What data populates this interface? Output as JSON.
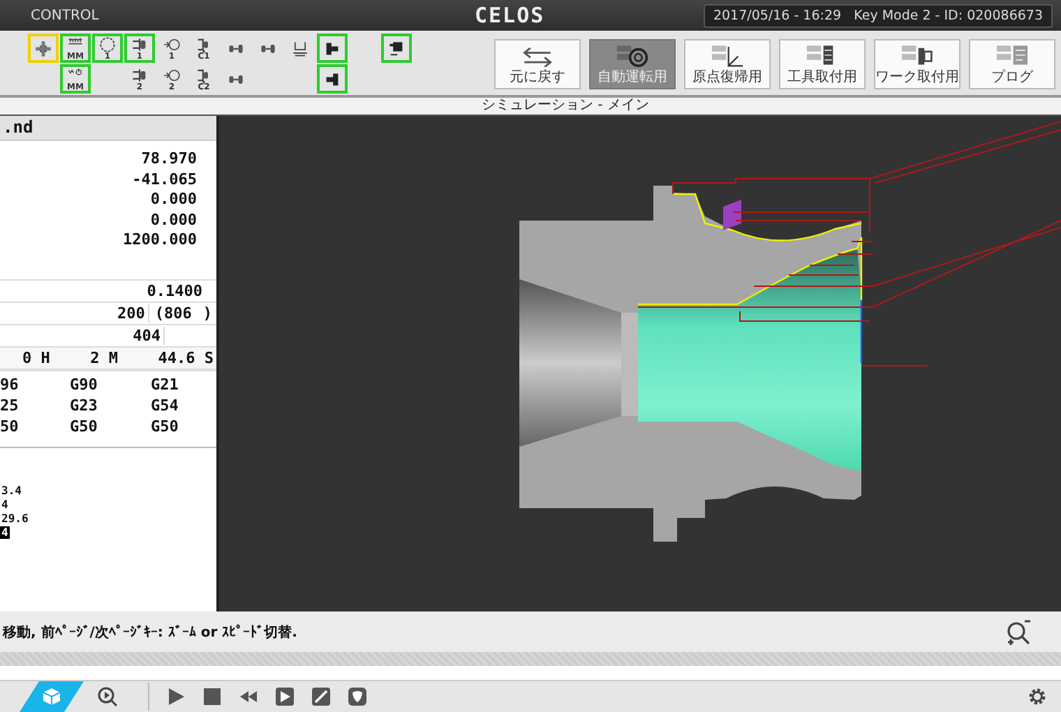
{
  "header": {
    "title": "CONTROL",
    "logo": "CELOS",
    "status": "2017/05/16 - 16:29   Key Mode 2 - ID: 020086673"
  },
  "toolbar": {
    "rows": [
      [
        {
          "kind": "chuck",
          "selected": true,
          "on": false
        },
        {
          "kind": "scale",
          "sub": "MM",
          "selected": false,
          "on": true
        },
        {
          "kind": "dial",
          "sub": "1",
          "selected": false,
          "on": true
        },
        {
          "kind": "clamp",
          "sub": "1",
          "selected": false,
          "on": true
        },
        {
          "kind": "feed",
          "sub": "1",
          "selected": false,
          "on": false
        },
        {
          "kind": "clamp-c",
          "sub": "C1",
          "selected": false,
          "on": false
        },
        {
          "kind": "spindle",
          "selected": false,
          "on": false
        },
        {
          "kind": "spindle",
          "selected": false,
          "on": false
        },
        {
          "kind": "tailstock",
          "selected": false,
          "on": false
        },
        {
          "kind": "jaw-left",
          "selected": false,
          "on": true
        },
        {
          "kind": "blank"
        },
        {
          "kind": "door",
          "selected": false,
          "on": true
        }
      ],
      [
        {
          "kind": "blank"
        },
        {
          "kind": "timer",
          "sub": "MM",
          "selected": false,
          "on": true
        },
        {
          "kind": "blank"
        },
        {
          "kind": "clamp",
          "sub": "2",
          "selected": false,
          "on": false
        },
        {
          "kind": "feed",
          "sub": "2",
          "selected": false,
          "on": false
        },
        {
          "kind": "clamp-c",
          "sub": "C2",
          "selected": false,
          "on": false
        },
        {
          "kind": "spindle",
          "selected": false,
          "on": false
        },
        {
          "kind": "blank"
        },
        {
          "kind": "blank"
        },
        {
          "kind": "jaw-right",
          "selected": false,
          "on": true
        }
      ]
    ]
  },
  "mode_buttons": [
    {
      "kind": "back",
      "label": "元に戻す",
      "selected": false
    },
    {
      "kind": "auto",
      "label": "自動運転用",
      "selected": true
    },
    {
      "kind": "origin",
      "label": "原点復帰用",
      "selected": false
    },
    {
      "kind": "tool",
      "label": "工具取付用",
      "selected": false
    },
    {
      "kind": "work",
      "label": "ワーク取付用",
      "selected": false
    },
    {
      "kind": "program",
      "label": "プログ",
      "selected": false
    }
  ],
  "panel": {
    "title": "シミュレーション - メイン"
  },
  "program": {
    "file": ".nd",
    "axes": [
      "78.970",
      "-41.065",
      "0.000",
      "0.000",
      "1200.000"
    ],
    "feed": "0.1400",
    "spindle": [
      "200",
      "(",
      "806",
      ")"
    ],
    "row_3": "404",
    "counters": [
      "0 H",
      "2 M",
      "44.6 S"
    ],
    "modal": [
      [
        "96",
        "G90",
        "G21"
      ],
      [
        "25",
        "G23",
        "G54"
      ],
      [
        "50",
        "G50",
        "G50"
      ]
    ],
    "lines": [
      {
        "text": "3.4",
        "selected": false
      },
      {
        "text": "4",
        "selected": false
      },
      {
        "text": "29.6",
        "selected": false
      },
      {
        "text": "4",
        "selected": true
      }
    ]
  },
  "message": "移動, 前ﾍﾟｰｼﾞ/次ﾍﾟｰｼﾞｷｰ: ｽﾞｰﾑ or ｽﾋﾟｰﾄﾞ切替.",
  "bottom_tabs": [
    {
      "kind": "cube",
      "selected": true
    },
    {
      "kind": "playback",
      "selected": false
    }
  ]
}
